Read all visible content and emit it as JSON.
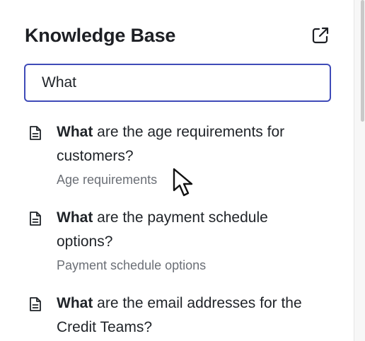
{
  "header": {
    "title": "Knowledge Base",
    "open_external_icon": "external-link-icon"
  },
  "search": {
    "value": "What",
    "placeholder": ""
  },
  "results": [
    {
      "icon": "document-icon",
      "match": "What",
      "rest_line1": " are the age requirements for",
      "line2": "customers?",
      "subtitle": "Age requirements"
    },
    {
      "icon": "document-icon",
      "match": "What",
      "rest_line1": " are the payment schedule",
      "line2": "options?",
      "subtitle": "Payment schedule options"
    },
    {
      "icon": "document-icon",
      "match": "What",
      "rest_line1": " are the email addresses for the",
      "line2": "Credit Teams?",
      "subtitle": ""
    }
  ],
  "colors": {
    "accent_border": "#3f4bb8",
    "text_primary": "#1f2328",
    "text_secondary": "#6b6f76"
  },
  "overlay": {
    "cursor_icon": "mouse-pointer-icon"
  }
}
